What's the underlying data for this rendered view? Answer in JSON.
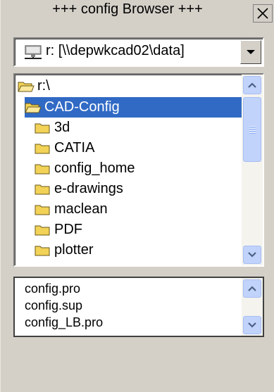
{
  "window": {
    "title": "+++ config Browser +++",
    "close_label": "X"
  },
  "drive": {
    "selected": "r: [\\\\depwkcad02\\data]",
    "icon": "network-drive-icon"
  },
  "directories": [
    {
      "label": "r:\\",
      "icon": "open-folder-icon",
      "selected": false
    },
    {
      "label": "CAD-Config",
      "icon": "open-folder-icon",
      "selected": true
    },
    {
      "label": "3d",
      "icon": "folder-icon",
      "selected": false
    },
    {
      "label": "CATIA",
      "icon": "folder-icon",
      "selected": false
    },
    {
      "label": "config_home",
      "icon": "folder-icon",
      "selected": false
    },
    {
      "label": "e-drawings",
      "icon": "folder-icon",
      "selected": false
    },
    {
      "label": "maclean",
      "icon": "folder-icon",
      "selected": false
    },
    {
      "label": "PDF",
      "icon": "folder-icon",
      "selected": false
    },
    {
      "label": "plotter",
      "icon": "folder-icon",
      "selected": false
    }
  ],
  "files": [
    {
      "label": "config.pro"
    },
    {
      "label": "config.sup"
    },
    {
      "label": "config_LB.pro"
    }
  ],
  "colors": {
    "background": "#d4d0c8",
    "selection": "#316ac5",
    "scrollbar": "#c1d3fb",
    "folder": "#f2d257"
  }
}
